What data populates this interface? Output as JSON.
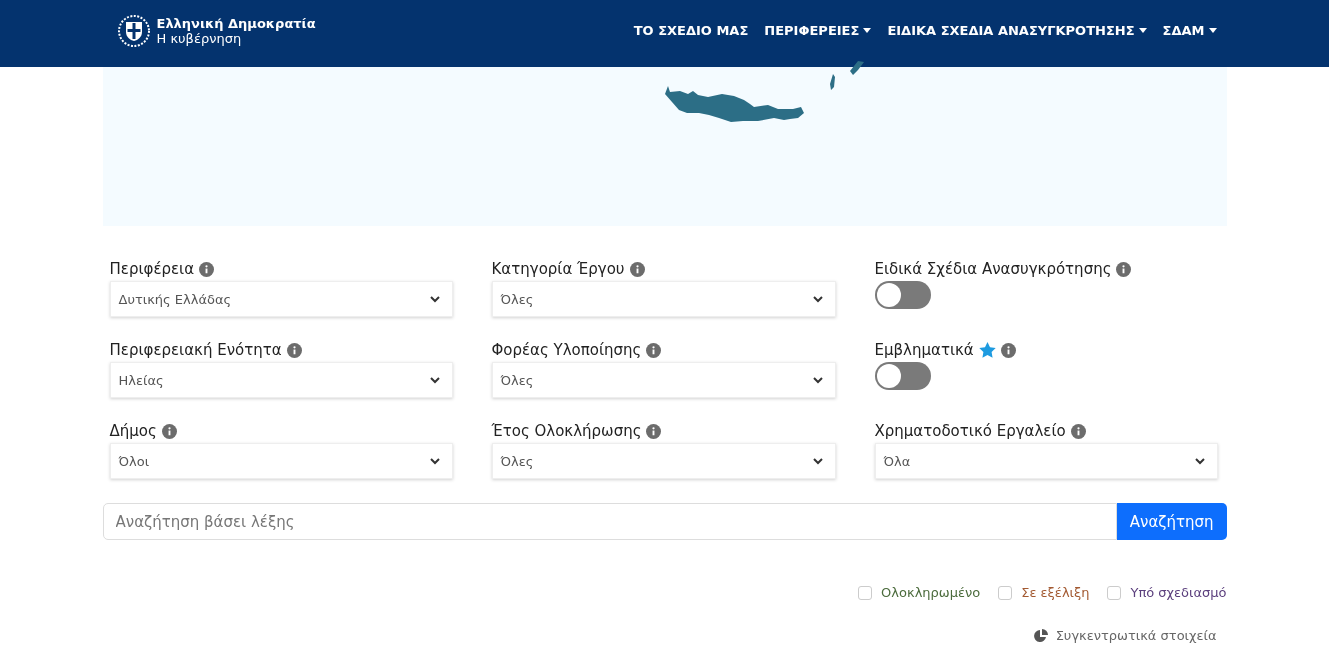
{
  "header": {
    "logo": {
      "title": "Ελληνική Δημοκρατία",
      "subtitle": "Η κυβέρνηση"
    },
    "nav": [
      {
        "label": "ΤΟ ΣΧΕΔΙΟ ΜΑΣ",
        "kind": "link"
      },
      {
        "label": "ΠΕΡΙΦΕΡΕΙΕΣ",
        "kind": "dropdown"
      },
      {
        "label": "ΕΙΔΙΚΑ ΣΧΕΔΙΑ ΑΝΑΣΥΓΚΡΟΤΗΣΗΣ",
        "kind": "dropdown"
      },
      {
        "label": "ΣΔΑΜ",
        "kind": "dropdown"
      }
    ]
  },
  "filters": [
    [
      {
        "kind": "select",
        "label": "Περιφέρεια",
        "value": "Δυτικής Ελλάδας"
      },
      {
        "kind": "select",
        "label": "Περιφερειακή Ενότητα",
        "value": "Ηλείας"
      },
      {
        "kind": "select",
        "label": "Δήμος",
        "value": "Όλοι"
      }
    ],
    [
      {
        "kind": "select",
        "label": "Κατηγορία Έργου",
        "value": "Όλες"
      },
      {
        "kind": "select",
        "label": "Φορέας Υλοποίησης",
        "value": "Όλες"
      },
      {
        "kind": "select",
        "label": "Έτος Ολοκλήρωσης",
        "value": "Όλες"
      }
    ],
    [
      {
        "kind": "toggle",
        "label": "Ειδικά Σχέδια Ανασυγκρότησης",
        "on": false,
        "starred": false
      },
      {
        "kind": "toggle",
        "label": "Εμβληματικά",
        "on": false,
        "starred": true
      },
      {
        "kind": "select",
        "label": "Χρηματοδοτικό Εργαλείο",
        "value": "Όλα"
      }
    ]
  ],
  "search": {
    "placeholder": "Αναζήτηση βάσει λέξης",
    "button": "Αναζήτηση"
  },
  "status_filters": [
    {
      "label": "Ολοκληρωμένο",
      "checked": false,
      "color": "#4b6b3c"
    },
    {
      "label": "Σε εξέλιξη",
      "checked": false,
      "color": "#a35a32"
    },
    {
      "label": "Υπό σχεδιασμό",
      "checked": false,
      "color": "#5b3f7d"
    }
  ],
  "summary_link": "Συγκεντρωτικά στοιχεία"
}
